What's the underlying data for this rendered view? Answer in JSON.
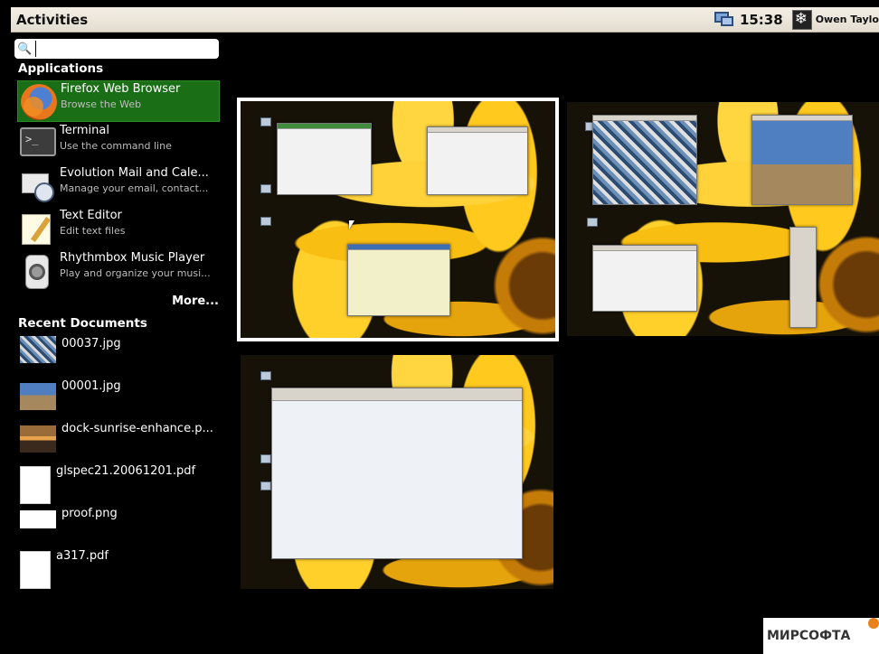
{
  "top_panel": {
    "activities_label": "Activities",
    "clock": "15:38",
    "user_name": "Owen Taylo",
    "network_icon": "network-icon",
    "avatar_icon": "user-avatar-icon"
  },
  "search": {
    "value": "",
    "placeholder": "",
    "icon": "search-icon"
  },
  "applications": {
    "title": "Applications",
    "items": [
      {
        "name": "Firefox Web Browser",
        "description": "Browse the Web",
        "icon": "firefox-icon",
        "selected": true
      },
      {
        "name": "Terminal",
        "description": "Use the command line",
        "icon": "terminal-icon"
      },
      {
        "name": "Evolution Mail and Cale...",
        "description": "Manage your email, contact...",
        "icon": "evolution-icon"
      },
      {
        "name": "Text Editor",
        "description": "Edit text files",
        "icon": "text-editor-icon"
      },
      {
        "name": "Rhythmbox Music Player",
        "description": "Play and organize your musi...",
        "icon": "rhythmbox-icon"
      }
    ],
    "more_label": "More..."
  },
  "recent_documents": {
    "title": "Recent Documents",
    "items": [
      {
        "name": "00037.jpg",
        "thumb": "carpet-thumbnail"
      },
      {
        "name": "00001.jpg",
        "thumb": "mosque-thumbnail"
      },
      {
        "name": "dock-sunrise-enhance.p...",
        "thumb": "sunrise-thumbnail"
      },
      {
        "name": "glspec21.20061201.pdf",
        "thumb": "pdf-thumbnail"
      },
      {
        "name": "proof.png",
        "thumb": "proof-thumbnail"
      },
      {
        "name": "a317.pdf",
        "thumb": "pdf-thumbnail"
      }
    ]
  },
  "workspaces": [
    {
      "name": "workspace-1",
      "active": true
    },
    {
      "name": "workspace-2",
      "active": false
    },
    {
      "name": "workspace-3",
      "active": false
    }
  ],
  "watermark": {
    "text": "МИРСОФТА"
  },
  "colors": {
    "selected_item": "#1a6e15",
    "panel": "#f4efe6",
    "background": "#000000"
  }
}
